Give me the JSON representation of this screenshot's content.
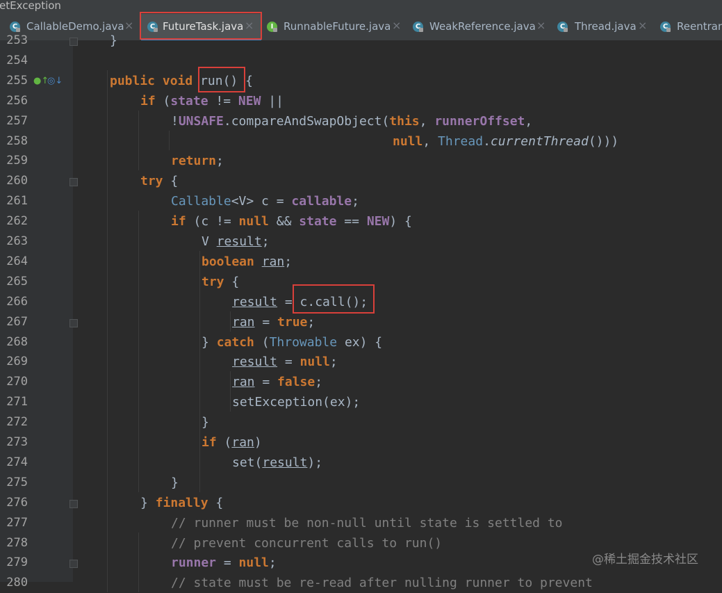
{
  "window": {
    "breadcrumb": "etException"
  },
  "tabs": [
    {
      "label": "CallableDemo.java",
      "icon_letter": "C",
      "icon_color": "#3e86a0",
      "icon": "class-icon",
      "active": false
    },
    {
      "label": "FutureTask.java",
      "icon_letter": "C",
      "icon_color": "#3e86a0",
      "icon": "class-icon",
      "active": true
    },
    {
      "label": "RunnableFuture.java",
      "icon_letter": "I",
      "icon_color": "#62b543",
      "icon": "interface-icon",
      "active": false
    },
    {
      "label": "WeakReference.java",
      "icon_letter": "C",
      "icon_color": "#3e86a0",
      "icon": "class-icon",
      "active": false
    },
    {
      "label": "Thread.java",
      "icon_letter": "C",
      "icon_color": "#3e86a0",
      "icon": "class-icon",
      "active": false
    },
    {
      "label": "Reentran",
      "icon_letter": "C",
      "icon_color": "#3e86a0",
      "icon": "class-icon",
      "active": false
    }
  ],
  "tab_close_glyph": "×",
  "code_lines": [
    {
      "n": "253",
      "text": "}"
    },
    {
      "n": "254",
      "text": ""
    },
    {
      "n": "255",
      "text": "public void run() {"
    },
    {
      "n": "256",
      "text": "if (state != NEW ||"
    },
    {
      "n": "257",
      "text": "!UNSAFE.compareAndSwapObject(this, runnerOffset,"
    },
    {
      "n": "258",
      "text": "null, Thread.currentThread()))"
    },
    {
      "n": "259",
      "text": "return;"
    },
    {
      "n": "260",
      "text": "try {"
    },
    {
      "n": "261",
      "text": "Callable<V> c = callable;"
    },
    {
      "n": "262",
      "text": "if (c != null && state == NEW) {"
    },
    {
      "n": "263",
      "text": "V result;"
    },
    {
      "n": "264",
      "text": "boolean ran;"
    },
    {
      "n": "265",
      "text": "try {"
    },
    {
      "n": "266",
      "text": "result = c.call();"
    },
    {
      "n": "267",
      "text": "ran = true;"
    },
    {
      "n": "268",
      "text": "} catch (Throwable ex) {"
    },
    {
      "n": "269",
      "text": "result = null;"
    },
    {
      "n": "270",
      "text": "ran = false;"
    },
    {
      "n": "271",
      "text": "setException(ex);"
    },
    {
      "n": "272",
      "text": "}"
    },
    {
      "n": "273",
      "text": "if (ran)"
    },
    {
      "n": "274",
      "text": "set(result);"
    },
    {
      "n": "275",
      "text": "}"
    },
    {
      "n": "276",
      "text": "} finally {"
    },
    {
      "n": "277",
      "text": "// runner must be non-null until state is settled to"
    },
    {
      "n": "278",
      "text": "// prevent concurrent calls to run()"
    },
    {
      "n": "279",
      "text": "runner = null;"
    },
    {
      "n": "280",
      "text": "// state must be re-read after nulling runner to prevent"
    }
  ],
  "gutter_markers": {
    "line_255": [
      "implements-marker-icon",
      "overrides-marker-icon"
    ]
  },
  "highlights": [
    "tab-FutureTask.java",
    "run",
    "c.call();"
  ],
  "watermark": "@稀土掘金技术社区",
  "colors": {
    "keyword": "#cc7832",
    "field": "#9876aa",
    "type": "#6897bb",
    "comment": "#808080",
    "text": "#a9b7c6",
    "highlight_box": "#d9403a",
    "active_tab_underline": "#4a88c7"
  }
}
